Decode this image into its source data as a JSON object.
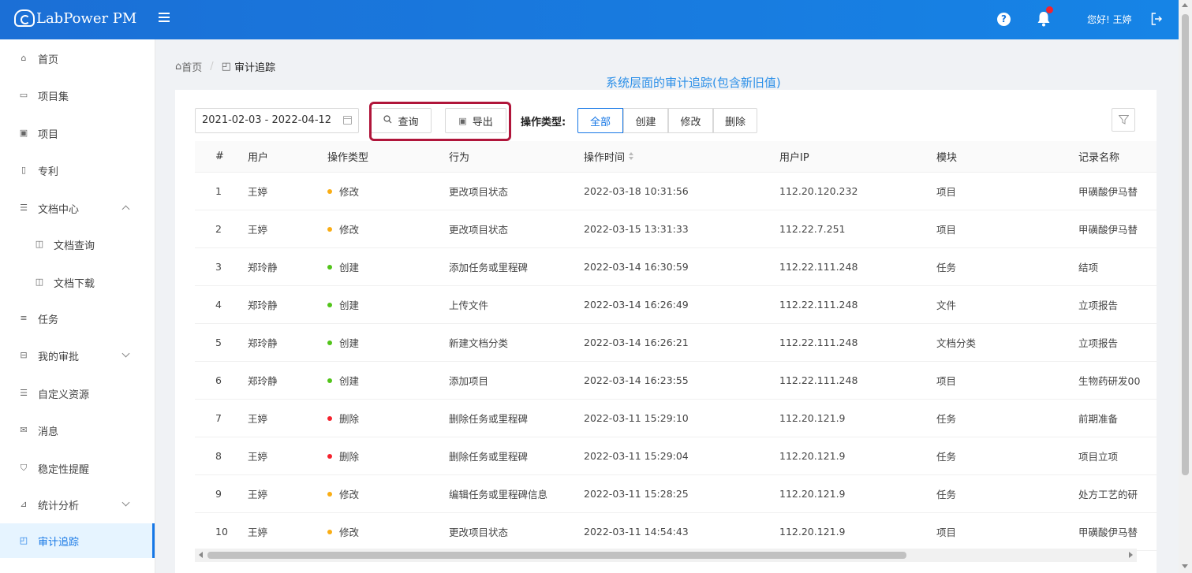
{
  "header": {
    "brand": "LabPower PM",
    "greeting": "您好! 王婷"
  },
  "sidebar": {
    "items": [
      {
        "label": "首页",
        "icon": "home-icon"
      },
      {
        "label": "项目集",
        "icon": "folder-set-icon"
      },
      {
        "label": "项目",
        "icon": "project-icon"
      },
      {
        "label": "专利",
        "icon": "patent-icon"
      },
      {
        "label": "文档中心",
        "icon": "docs-icon"
      },
      {
        "label": "文档查询",
        "icon": "doc-query-icon"
      },
      {
        "label": "文档下载",
        "icon": "doc-download-icon"
      },
      {
        "label": "任务",
        "icon": "task-icon"
      },
      {
        "label": "我的审批",
        "icon": "approval-icon"
      },
      {
        "label": "自定义资源",
        "icon": "resource-icon"
      },
      {
        "label": "消息",
        "icon": "message-icon"
      },
      {
        "label": "稳定性提醒",
        "icon": "shield-icon"
      },
      {
        "label": "统计分析",
        "icon": "chart-icon"
      },
      {
        "label": "审计追踪",
        "icon": "audit-icon"
      }
    ]
  },
  "breadcrumb": {
    "home": "首页",
    "current": "审计追踪"
  },
  "annotation": "系统层面的审计追踪(包含新旧值)",
  "toolbar": {
    "date_range": "2021-02-03 - 2022-04-12",
    "query_label": "查询",
    "export_label": "导出",
    "op_type_label": "操作类型:",
    "op_types": [
      "全部",
      "创建",
      "修改",
      "删除"
    ],
    "active_op_type": "全部"
  },
  "colors": {
    "accent": "#1677e6",
    "highlight_border": "#b0153a",
    "modify_dot": "#faad14",
    "create_dot": "#52c41a",
    "delete_dot": "#f5222d"
  },
  "table": {
    "headers": {
      "index": "#",
      "user": "用户",
      "op_type": "操作类型",
      "action": "行为",
      "op_time": "操作时间",
      "ip": "用户IP",
      "module": "模块",
      "record": "记录名称"
    },
    "rows": [
      {
        "index": "1",
        "user": "王婷",
        "op_type": "修改",
        "status": "modify",
        "action": "更改项目状态",
        "op_time": "2022-03-18 10:31:56",
        "ip": "112.20.120.232",
        "module": "项目",
        "record": "甲磺酸伊马替"
      },
      {
        "index": "2",
        "user": "王婷",
        "op_type": "修改",
        "status": "modify",
        "action": "更改项目状态",
        "op_time": "2022-03-15 13:31:33",
        "ip": "112.22.7.251",
        "module": "项目",
        "record": "甲磺酸伊马替"
      },
      {
        "index": "3",
        "user": "郑玲静",
        "op_type": "创建",
        "status": "create",
        "action": "添加任务或里程碑",
        "op_time": "2022-03-14 16:30:59",
        "ip": "112.22.111.248",
        "module": "任务",
        "record": "结项"
      },
      {
        "index": "4",
        "user": "郑玲静",
        "op_type": "创建",
        "status": "create",
        "action": "上传文件",
        "op_time": "2022-03-14 16:26:49",
        "ip": "112.22.111.248",
        "module": "文件",
        "record": "立项报告"
      },
      {
        "index": "5",
        "user": "郑玲静",
        "op_type": "创建",
        "status": "create",
        "action": "新建文档分类",
        "op_time": "2022-03-14 16:26:21",
        "ip": "112.22.111.248",
        "module": "文档分类",
        "record": "立项报告"
      },
      {
        "index": "6",
        "user": "郑玲静",
        "op_type": "创建",
        "status": "create",
        "action": "添加项目",
        "op_time": "2022-03-14 16:23:55",
        "ip": "112.22.111.248",
        "module": "项目",
        "record": "生物药研发00"
      },
      {
        "index": "7",
        "user": "王婷",
        "op_type": "删除",
        "status": "delete",
        "action": "删除任务或里程碑",
        "op_time": "2022-03-11 15:29:10",
        "ip": "112.20.121.9",
        "module": "任务",
        "record": "前期准备"
      },
      {
        "index": "8",
        "user": "王婷",
        "op_type": "删除",
        "status": "delete",
        "action": "删除任务或里程碑",
        "op_time": "2022-03-11 15:29:04",
        "ip": "112.20.121.9",
        "module": "任务",
        "record": "项目立项"
      },
      {
        "index": "9",
        "user": "王婷",
        "op_type": "修改",
        "status": "modify",
        "action": "编辑任务或里程碑信息",
        "op_time": "2022-03-11 15:28:25",
        "ip": "112.20.121.9",
        "module": "任务",
        "record": "处方工艺的研"
      },
      {
        "index": "10",
        "user": "王婷",
        "op_type": "修改",
        "status": "modify",
        "action": "更改项目状态",
        "op_time": "2022-03-11 14:54:43",
        "ip": "112.20.121.9",
        "module": "项目",
        "record": "甲磺酸伊马替"
      }
    ]
  }
}
